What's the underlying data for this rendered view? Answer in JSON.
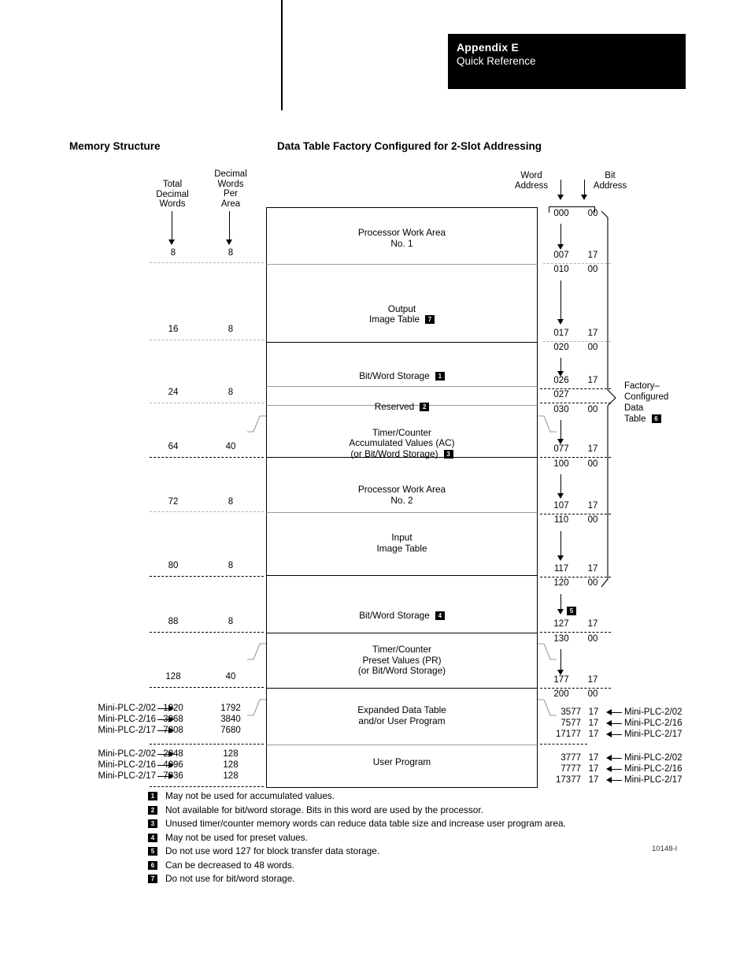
{
  "header": {
    "appendix": "Appendix E",
    "subtitle": "Quick Reference"
  },
  "titles": {
    "left": "Memory Structure",
    "right": "Data Table Factory Configured for 2-Slot Addressing"
  },
  "column_headers": {
    "total_decimal_words": "Total\nDecimal\nWords",
    "decimal_words_per_area": "Decimal\nWords\nPer\nArea",
    "word_address": "Word\nAddress",
    "bit_address": "Bit\nAddress"
  },
  "factory_bracket": {
    "label": "Factory–\nConfigured\nData\nTable",
    "marker": "6"
  },
  "blocks": [
    {
      "label": "Processor Work Area\nNo. 1",
      "marker": "",
      "total": "8",
      "per_area": "8"
    },
    {
      "label": "Output\nImage Table",
      "marker": "7",
      "total": "16",
      "per_area": "8"
    },
    {
      "label": "Bit/Word Storage",
      "marker": "1",
      "total": "24",
      "per_area": "8"
    },
    {
      "label": "Reserved",
      "marker": "2",
      "total": "",
      "per_area": ""
    },
    {
      "label": "Timer/Counter\nAccumulated Values (AC)\n(or Bit/Word Storage)",
      "marker": "3",
      "total": "64",
      "per_area": "40"
    },
    {
      "label": "Processor Work Area\nNo. 2",
      "marker": "",
      "total": "72",
      "per_area": "8"
    },
    {
      "label": "Input\nImage Table",
      "marker": "",
      "total": "80",
      "per_area": "8"
    },
    {
      "label": "Bit/Word Storage",
      "marker": "4",
      "total": "88",
      "per_area": "8"
    },
    {
      "label": "Timer/Counter\nPreset Values (PR)\n(or Bit/Word Storage)",
      "marker": "",
      "total": "128",
      "per_area": "40"
    },
    {
      "label": "Expanded Data Table\nand/or User Program",
      "marker": "",
      "total": "",
      "per_area": ""
    },
    {
      "label": "User Program",
      "marker": "",
      "total": "",
      "per_area": ""
    }
  ],
  "addresses": [
    {
      "word": "000",
      "bit": "00"
    },
    {
      "word": "007",
      "bit": "17"
    },
    {
      "word": "010",
      "bit": "00"
    },
    {
      "word": "017",
      "bit": "17"
    },
    {
      "word": "020",
      "bit": "00"
    },
    {
      "word": "026",
      "bit": "17"
    },
    {
      "word": "027",
      "bit": ""
    },
    {
      "word": "030",
      "bit": "00"
    },
    {
      "word": "077",
      "bit": "17"
    },
    {
      "word": "100",
      "bit": "00"
    },
    {
      "word": "107",
      "bit": "17"
    },
    {
      "word": "110",
      "bit": "00"
    },
    {
      "word": "117",
      "bit": "17"
    },
    {
      "word": "120",
      "bit": "00"
    },
    {
      "word": "127",
      "bit": "17"
    },
    {
      "word": "130",
      "bit": "00"
    },
    {
      "word": "177",
      "bit": "17"
    },
    {
      "word": "200",
      "bit": "00"
    }
  ],
  "word_127_marker": "5",
  "expanded_rows_left": [
    {
      "model": "Mini-PLC-2/02",
      "total": "1920",
      "per_area": "1792"
    },
    {
      "model": "Mini-PLC-2/16",
      "total": "3968",
      "per_area": "3840"
    },
    {
      "model": "Mini-PLC-2/17",
      "total": "7808",
      "per_area": "7680"
    }
  ],
  "user_program_rows_left": [
    {
      "model": "Mini-PLC-2/02",
      "total": "2048",
      "per_area": "128"
    },
    {
      "model": "Mini-PLC-2/16",
      "total": "4096",
      "per_area": "128"
    },
    {
      "model": "Mini-PLC-2/17",
      "total": "7936",
      "per_area": "128"
    }
  ],
  "expanded_rows_right": [
    {
      "word": "3577",
      "bit": "17",
      "model": "Mini-PLC-2/02"
    },
    {
      "word": "7577",
      "bit": "17",
      "model": "Mini-PLC-2/16"
    },
    {
      "word": "17177",
      "bit": "17",
      "model": "Mini-PLC-2/17"
    }
  ],
  "user_program_rows_right": [
    {
      "word": "3777",
      "bit": "17",
      "model": "Mini-PLC-2/02"
    },
    {
      "word": "7777",
      "bit": "17",
      "model": "Mini-PLC-2/16"
    },
    {
      "word": "17377",
      "bit": "17",
      "model": "Mini-PLC-2/17"
    }
  ],
  "footnotes": [
    {
      "marker": "1",
      "text": "May not be used for accumulated values."
    },
    {
      "marker": "2",
      "text": "Not available for bit/word storage.  Bits in this word are used by the processor."
    },
    {
      "marker": "3",
      "text": "Unused timer/counter memory words can reduce data table size and increase user program area."
    },
    {
      "marker": "4",
      "text": "May not be used for preset values."
    },
    {
      "marker": "5",
      "text": "Do not use word 127 for block transfer data storage."
    },
    {
      "marker": "6",
      "text": "Can be decreased to 48 words."
    },
    {
      "marker": "7",
      "text": "Do not use for bit/word storage."
    }
  ],
  "figure_id": "10148-I"
}
